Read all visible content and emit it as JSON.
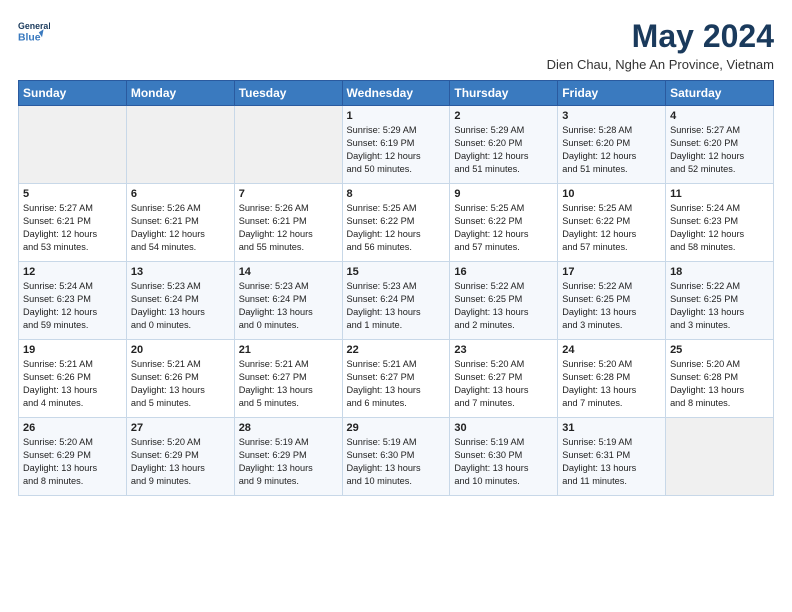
{
  "header": {
    "logo_line1": "General",
    "logo_line2": "Blue",
    "month": "May 2024",
    "location": "Dien Chau, Nghe An Province, Vietnam"
  },
  "days_of_week": [
    "Sunday",
    "Monday",
    "Tuesday",
    "Wednesday",
    "Thursday",
    "Friday",
    "Saturday"
  ],
  "weeks": [
    [
      {
        "day": "",
        "content": ""
      },
      {
        "day": "",
        "content": ""
      },
      {
        "day": "",
        "content": ""
      },
      {
        "day": "1",
        "content": "Sunrise: 5:29 AM\nSunset: 6:19 PM\nDaylight: 12 hours\nand 50 minutes."
      },
      {
        "day": "2",
        "content": "Sunrise: 5:29 AM\nSunset: 6:20 PM\nDaylight: 12 hours\nand 51 minutes."
      },
      {
        "day": "3",
        "content": "Sunrise: 5:28 AM\nSunset: 6:20 PM\nDaylight: 12 hours\nand 51 minutes."
      },
      {
        "day": "4",
        "content": "Sunrise: 5:27 AM\nSunset: 6:20 PM\nDaylight: 12 hours\nand 52 minutes."
      }
    ],
    [
      {
        "day": "5",
        "content": "Sunrise: 5:27 AM\nSunset: 6:21 PM\nDaylight: 12 hours\nand 53 minutes."
      },
      {
        "day": "6",
        "content": "Sunrise: 5:26 AM\nSunset: 6:21 PM\nDaylight: 12 hours\nand 54 minutes."
      },
      {
        "day": "7",
        "content": "Sunrise: 5:26 AM\nSunset: 6:21 PM\nDaylight: 12 hours\nand 55 minutes."
      },
      {
        "day": "8",
        "content": "Sunrise: 5:25 AM\nSunset: 6:22 PM\nDaylight: 12 hours\nand 56 minutes."
      },
      {
        "day": "9",
        "content": "Sunrise: 5:25 AM\nSunset: 6:22 PM\nDaylight: 12 hours\nand 57 minutes."
      },
      {
        "day": "10",
        "content": "Sunrise: 5:25 AM\nSunset: 6:22 PM\nDaylight: 12 hours\nand 57 minutes."
      },
      {
        "day": "11",
        "content": "Sunrise: 5:24 AM\nSunset: 6:23 PM\nDaylight: 12 hours\nand 58 minutes."
      }
    ],
    [
      {
        "day": "12",
        "content": "Sunrise: 5:24 AM\nSunset: 6:23 PM\nDaylight: 12 hours\nand 59 minutes."
      },
      {
        "day": "13",
        "content": "Sunrise: 5:23 AM\nSunset: 6:24 PM\nDaylight: 13 hours\nand 0 minutes."
      },
      {
        "day": "14",
        "content": "Sunrise: 5:23 AM\nSunset: 6:24 PM\nDaylight: 13 hours\nand 0 minutes."
      },
      {
        "day": "15",
        "content": "Sunrise: 5:23 AM\nSunset: 6:24 PM\nDaylight: 13 hours\nand 1 minute."
      },
      {
        "day": "16",
        "content": "Sunrise: 5:22 AM\nSunset: 6:25 PM\nDaylight: 13 hours\nand 2 minutes."
      },
      {
        "day": "17",
        "content": "Sunrise: 5:22 AM\nSunset: 6:25 PM\nDaylight: 13 hours\nand 3 minutes."
      },
      {
        "day": "18",
        "content": "Sunrise: 5:22 AM\nSunset: 6:25 PM\nDaylight: 13 hours\nand 3 minutes."
      }
    ],
    [
      {
        "day": "19",
        "content": "Sunrise: 5:21 AM\nSunset: 6:26 PM\nDaylight: 13 hours\nand 4 minutes."
      },
      {
        "day": "20",
        "content": "Sunrise: 5:21 AM\nSunset: 6:26 PM\nDaylight: 13 hours\nand 5 minutes."
      },
      {
        "day": "21",
        "content": "Sunrise: 5:21 AM\nSunset: 6:27 PM\nDaylight: 13 hours\nand 5 minutes."
      },
      {
        "day": "22",
        "content": "Sunrise: 5:21 AM\nSunset: 6:27 PM\nDaylight: 13 hours\nand 6 minutes."
      },
      {
        "day": "23",
        "content": "Sunrise: 5:20 AM\nSunset: 6:27 PM\nDaylight: 13 hours\nand 7 minutes."
      },
      {
        "day": "24",
        "content": "Sunrise: 5:20 AM\nSunset: 6:28 PM\nDaylight: 13 hours\nand 7 minutes."
      },
      {
        "day": "25",
        "content": "Sunrise: 5:20 AM\nSunset: 6:28 PM\nDaylight: 13 hours\nand 8 minutes."
      }
    ],
    [
      {
        "day": "26",
        "content": "Sunrise: 5:20 AM\nSunset: 6:29 PM\nDaylight: 13 hours\nand 8 minutes."
      },
      {
        "day": "27",
        "content": "Sunrise: 5:20 AM\nSunset: 6:29 PM\nDaylight: 13 hours\nand 9 minutes."
      },
      {
        "day": "28",
        "content": "Sunrise: 5:19 AM\nSunset: 6:29 PM\nDaylight: 13 hours\nand 9 minutes."
      },
      {
        "day": "29",
        "content": "Sunrise: 5:19 AM\nSunset: 6:30 PM\nDaylight: 13 hours\nand 10 minutes."
      },
      {
        "day": "30",
        "content": "Sunrise: 5:19 AM\nSunset: 6:30 PM\nDaylight: 13 hours\nand 10 minutes."
      },
      {
        "day": "31",
        "content": "Sunrise: 5:19 AM\nSunset: 6:31 PM\nDaylight: 13 hours\nand 11 minutes."
      },
      {
        "day": "",
        "content": ""
      }
    ]
  ]
}
